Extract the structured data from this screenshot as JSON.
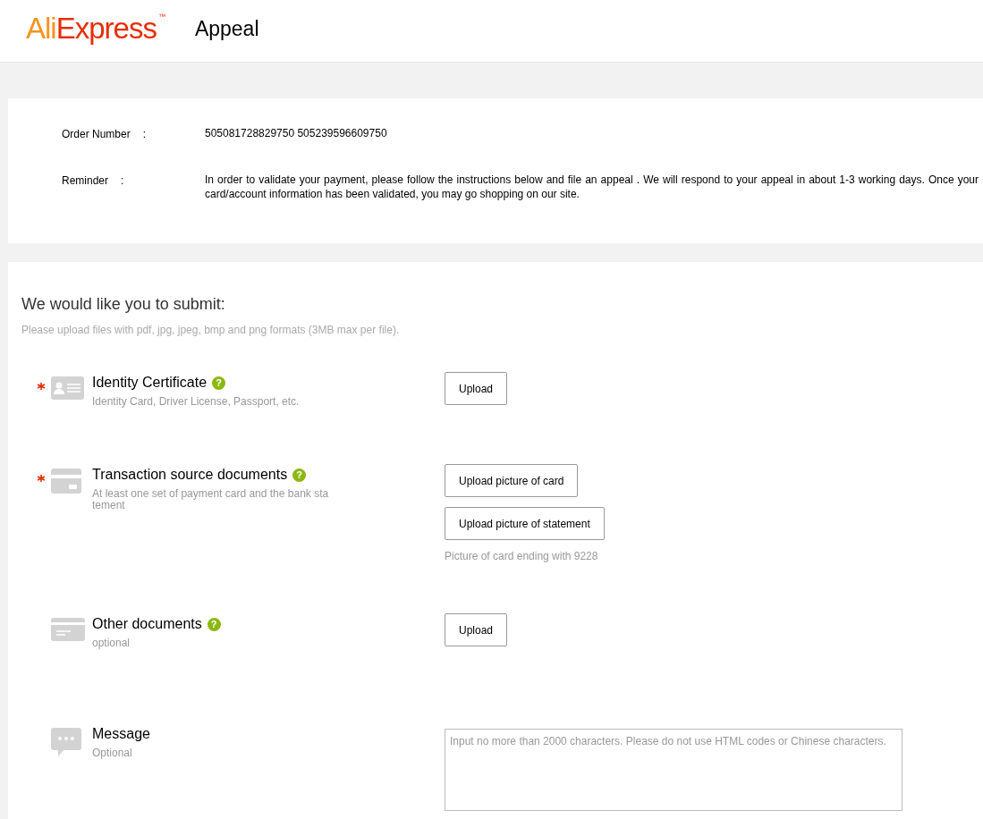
{
  "header": {
    "logo": {
      "first": "Ali",
      "second": "Express",
      "mark": "™"
    },
    "title": "Appeal"
  },
  "info": [
    {
      "label": "Order Number",
      "separator": ":",
      "value": "505081728829750  505239596609750"
    },
    {
      "label": "Reminder",
      "separator": ":",
      "value": "In order to validate your payment, please follow the instructions below and file an appeal . We will respond to your appeal in about 1-3 working days. Once your card/account information has been validated, you may go shopping on our site."
    }
  ],
  "submit": {
    "heading": "We would like you to submit:",
    "hint": "Please upload files with pdf, jpg, jpeg, bmp and png formats (3MB max per file).",
    "items": [
      {
        "kind": "id-card",
        "required": true,
        "title": "Identity Certificate",
        "help": "?",
        "description": "Identity Card, Driver License, Passport, etc.",
        "buttons": [
          "Upload"
        ]
      },
      {
        "kind": "card",
        "required": true,
        "title": "Transaction source documents",
        "help": "?",
        "description": "At least one set of payment card and the bank sta tement",
        "buttons": [
          "Upload picture of card",
          "Upload picture of statement"
        ],
        "note": "Picture of card ending with 9228"
      },
      {
        "kind": "document",
        "required": false,
        "title": "Other documents",
        "help": "?",
        "description": "optional",
        "buttons": [
          "Upload"
        ]
      },
      {
        "kind": "message",
        "required": false,
        "title": "Message",
        "description": "Optional",
        "placeholder": "Input no more than 2000 characters. Please do not use HTML codes or Chinese characters."
      }
    ]
  }
}
